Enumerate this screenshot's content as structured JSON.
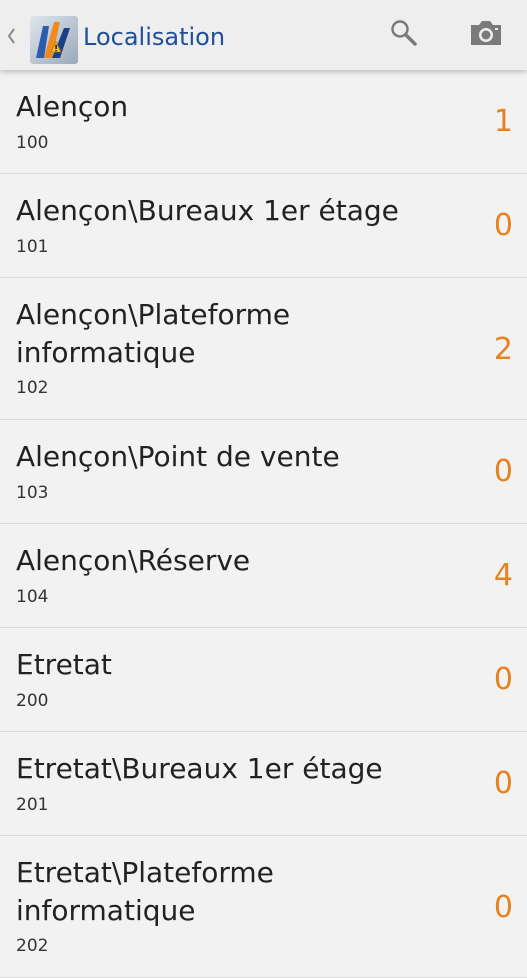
{
  "header": {
    "title": "Localisation",
    "icons": [
      "chevron-left-icon",
      "app-logo-icon",
      "search-icon",
      "camera-icon"
    ]
  },
  "colors": {
    "title": "#1e4f9c",
    "count": "#e8821e",
    "background": "#f2f2f2",
    "divider": "#dcdcdc"
  },
  "locations": [
    {
      "name": "Alençon",
      "code": "100",
      "count": "1"
    },
    {
      "name": "Alençon\\Bureaux 1er étage",
      "code": "101",
      "count": "0"
    },
    {
      "name": "Alençon\\Plateforme\ninformatique",
      "code": "102",
      "count": "2"
    },
    {
      "name": "Alençon\\Point de vente",
      "code": "103",
      "count": "0"
    },
    {
      "name": "Alençon\\Réserve",
      "code": "104",
      "count": "4"
    },
    {
      "name": "Etretat",
      "code": "200",
      "count": "0"
    },
    {
      "name": "Etretat\\Bureaux 1er étage",
      "code": "201",
      "count": "0"
    },
    {
      "name": "Etretat\\Plateforme\ninformatique",
      "code": "202",
      "count": "0"
    }
  ]
}
